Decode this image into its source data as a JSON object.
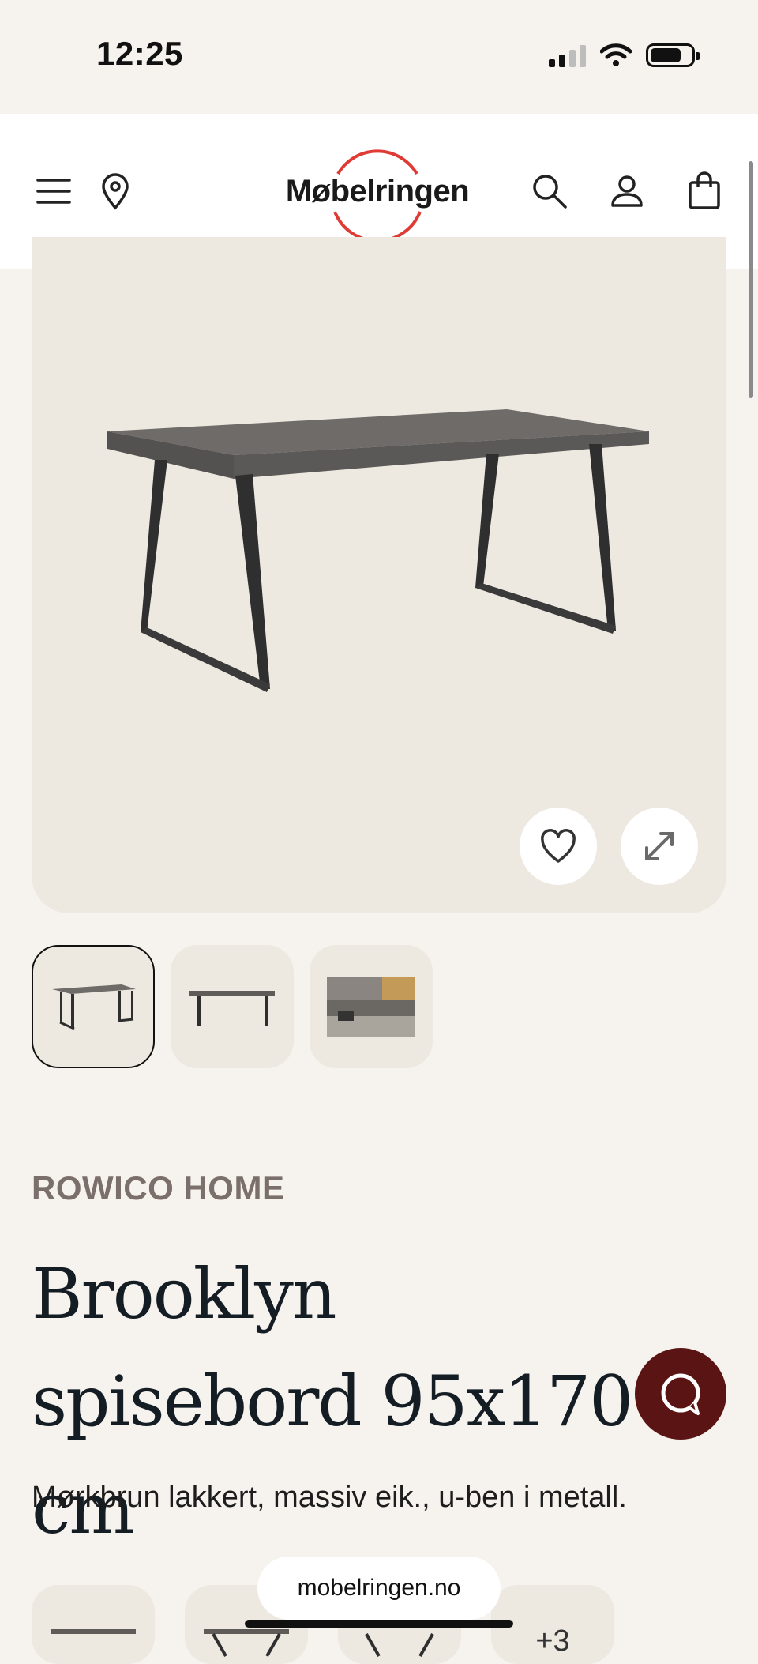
{
  "status_bar": {
    "time": "12:25"
  },
  "header": {
    "logo_text": "Møbelringen",
    "brand_color": "#e03a34",
    "icons": [
      "menu-icon",
      "location-pin-icon",
      "search-icon",
      "account-icon",
      "shopping-bag-icon"
    ]
  },
  "product": {
    "brand": "ROWICO HOME",
    "title": "Brooklyn spisebord 95x170 cm",
    "description": "Mørkbrun lakkert, massiv eik., u-ben i metall.",
    "image_count_more": "+3"
  },
  "browser": {
    "url": "mobelringen.no"
  },
  "colors": {
    "background": "#f6f2ee",
    "image_bg": "#ede8e0",
    "chat_button": "#5a1414",
    "brand_text": "#7b6f6b"
  }
}
